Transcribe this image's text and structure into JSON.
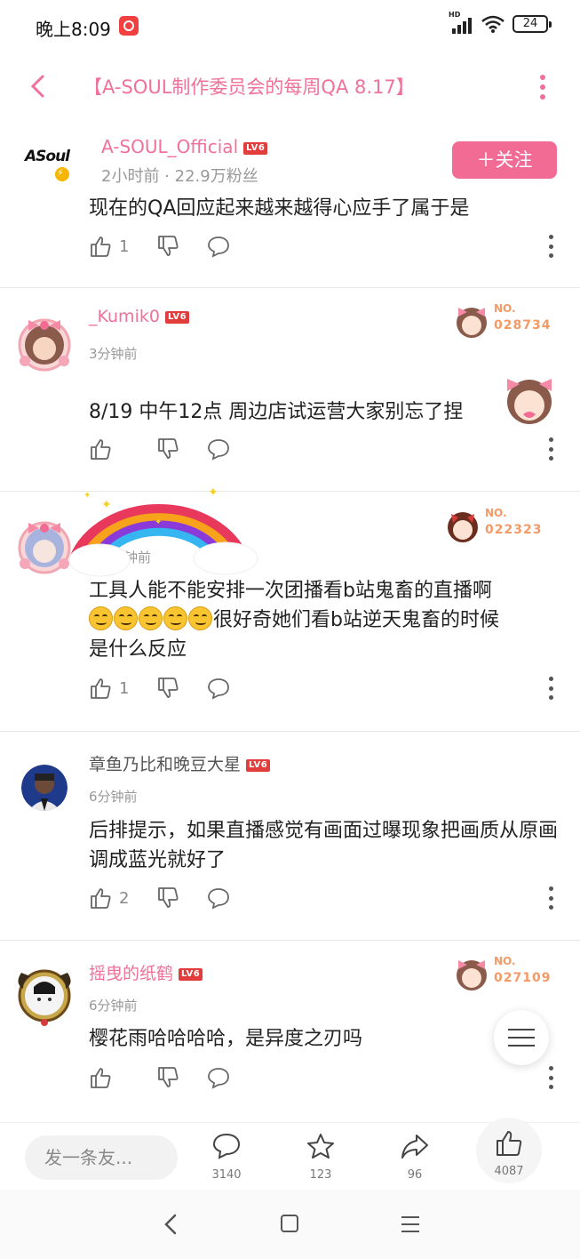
{
  "status_bar": {
    "time": "晚上8:09",
    "battery": "24",
    "signal_label": "HD"
  },
  "header": {
    "title": "【A-SOUL制作委员会的每周QA 8.17】"
  },
  "author": {
    "logo_text": "ASoul",
    "name": "A-SOUL_Official",
    "level": "LV6",
    "meta": "2小时前 · 22.9万粉丝",
    "follow_label": "＋关注"
  },
  "previous_comment": {
    "text_partial": "现在的QA回应起来越来越得心应手了属于是",
    "likes": "1"
  },
  "comments": [
    {
      "name": "_Kumik0",
      "level": "LV6",
      "time": "3分钟前",
      "text": "8/19 中午12点 周边店试运营大家别忘了捏",
      "likes": "",
      "fan_no_label": "NO.",
      "fan_no": "028734"
    },
    {
      "name": "",
      "level": "",
      "time": "钟前",
      "text_line1": "工具人能不能安排一次团播看b站鬼畜的直播啊",
      "text_line2": "很好奇她们看b站逆天鬼畜的时候",
      "text_line3": "是什么反应",
      "likes": "1",
      "fan_no_label": "NO.",
      "fan_no": "022323"
    },
    {
      "name": "章鱼乃比和晚豆大星",
      "level": "LV6",
      "time": "6分钟前",
      "text": "后排提示，如果直播感觉有画面过曝现象把画质从原画调成蓝光就好了",
      "likes": "2"
    },
    {
      "name": "摇曳的纸鹤",
      "level": "LV6",
      "time": "6分钟前",
      "text": "樱花雨哈哈哈哈，是异度之刃吗",
      "likes": "",
      "fan_no_label": "NO.",
      "fan_no": "027109"
    }
  ],
  "bottom_bar": {
    "input_placeholder": "发一条友...",
    "comments_count": "3140",
    "favorites_count": "123",
    "shares_count": "96",
    "likes_count": "4087"
  },
  "colors": {
    "accent": "#f07199",
    "follow_bg": "#f26b95",
    "level_badge": "#e23d3d",
    "fan_badge": "#f39a67"
  }
}
